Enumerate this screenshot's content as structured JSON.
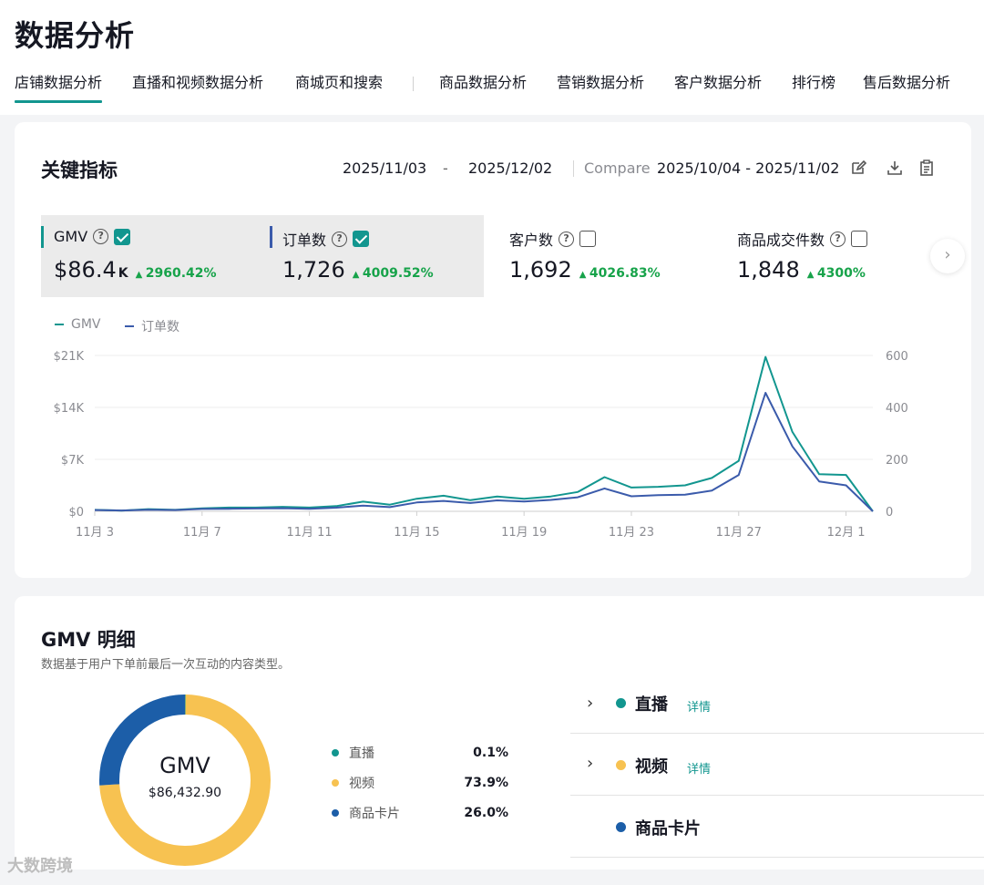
{
  "page": {
    "title": "数据分析"
  },
  "tabs": [
    {
      "label": "店铺数据分析",
      "active": true
    },
    {
      "label": "直播和视频数据分析"
    },
    {
      "label": "商城页和搜索"
    },
    {
      "label": "商品数据分析"
    },
    {
      "label": "营销数据分析"
    },
    {
      "label": "客户数据分析"
    },
    {
      "label": "排行榜"
    },
    {
      "label": "售后数据分析"
    }
  ],
  "key_metrics": {
    "title": "关键指标",
    "date_start": "2025/11/03",
    "date_sep": "-",
    "date_end": "2025/12/02",
    "compare_label": "Compare",
    "compare_range": "2025/10/04 - 2025/11/02",
    "icons": [
      "edit-icon",
      "download-icon",
      "clipboard-icon"
    ],
    "cards": [
      {
        "label": "GMV",
        "prefix": "$",
        "value": "86.4",
        "unit": "K",
        "delta": "2960.42%",
        "checked": true,
        "accent": "#12968f"
      },
      {
        "label": "订单数",
        "prefix": "",
        "value": "1,726",
        "unit": "",
        "delta": "4009.52%",
        "checked": true,
        "accent": "#3b5bab"
      },
      {
        "label": "客户数",
        "prefix": "",
        "value": "1,692",
        "unit": "",
        "delta": "4026.83%",
        "checked": false
      },
      {
        "label": "商品成交件数",
        "prefix": "",
        "value": "1,848",
        "unit": "",
        "delta": "4300%",
        "checked": false
      }
    ]
  },
  "chart_data": {
    "type": "line",
    "x": [
      "11月 3",
      "11月 4",
      "11月 5",
      "11月 6",
      "11月 7",
      "11月 8",
      "11月 9",
      "11月 10",
      "11月 11",
      "11月 12",
      "11月 13",
      "11月 14",
      "11月 15",
      "11月 16",
      "11月 17",
      "11月 18",
      "11月 19",
      "11月 20",
      "11月 21",
      "11月 22",
      "11月 23",
      "11月 24",
      "11月 25",
      "11月 26",
      "11月 27",
      "11月 28",
      "11月 29",
      "11月 30",
      "12月 1",
      "12月 2"
    ],
    "xticks": [
      "11月 3",
      "11月 7",
      "11月 11",
      "11月 15",
      "11月 19",
      "11月 23",
      "11月 27",
      "12月 1"
    ],
    "y_left": {
      "ticks": [
        "$0",
        "$7K",
        "$14K",
        "$21K"
      ],
      "lim": [
        0,
        21000
      ]
    },
    "y_right": {
      "ticks": [
        "0",
        "200",
        "400",
        "600"
      ],
      "lim": [
        0,
        600
      ]
    },
    "grid": true,
    "legend_position": "top-left",
    "series": [
      {
        "name": "GMV",
        "axis": "left",
        "color": "#12968f",
        "values": [
          200,
          100,
          300,
          200,
          400,
          500,
          500,
          600,
          500,
          700,
          1300,
          900,
          1700,
          2100,
          1500,
          2000,
          1700,
          2000,
          2600,
          4600,
          3200,
          3300,
          3500,
          4500,
          6800,
          20800,
          10700,
          5000,
          4900,
          0
        ]
      },
      {
        "name": "订单数",
        "axis": "right",
        "color": "#3b5bab",
        "values": [
          5,
          3,
          6,
          5,
          9,
          10,
          11,
          12,
          10,
          14,
          22,
          16,
          34,
          40,
          32,
          42,
          38,
          44,
          54,
          88,
          58,
          62,
          64,
          80,
          140,
          456,
          250,
          115,
          100,
          0
        ]
      }
    ]
  },
  "gmv_detail": {
    "title": "GMV 明细",
    "subtitle": "数据基于用户下单前最后一次互动的内容类型。",
    "center_title": "GMV",
    "center_value": "$86,432.90",
    "shares": [
      {
        "label": "直播",
        "value": "0.1%",
        "pct": 0.1,
        "color": "#12968f"
      },
      {
        "label": "视频",
        "value": "73.9%",
        "pct": 73.9,
        "color": "#f7c251"
      },
      {
        "label": "商品卡片",
        "value": "26.0%",
        "pct": 26.0,
        "color": "#1c5ea8"
      }
    ],
    "rows": [
      {
        "label": "直播",
        "link": "详情",
        "color": "#12968f",
        "expandable": true
      },
      {
        "label": "视频",
        "link": "详情",
        "color": "#f7c251",
        "expandable": true
      },
      {
        "label": "商品卡片",
        "link": "",
        "color": "#1c5ea8",
        "expandable": false
      }
    ]
  },
  "footer": {
    "badge": "大数跨境"
  }
}
